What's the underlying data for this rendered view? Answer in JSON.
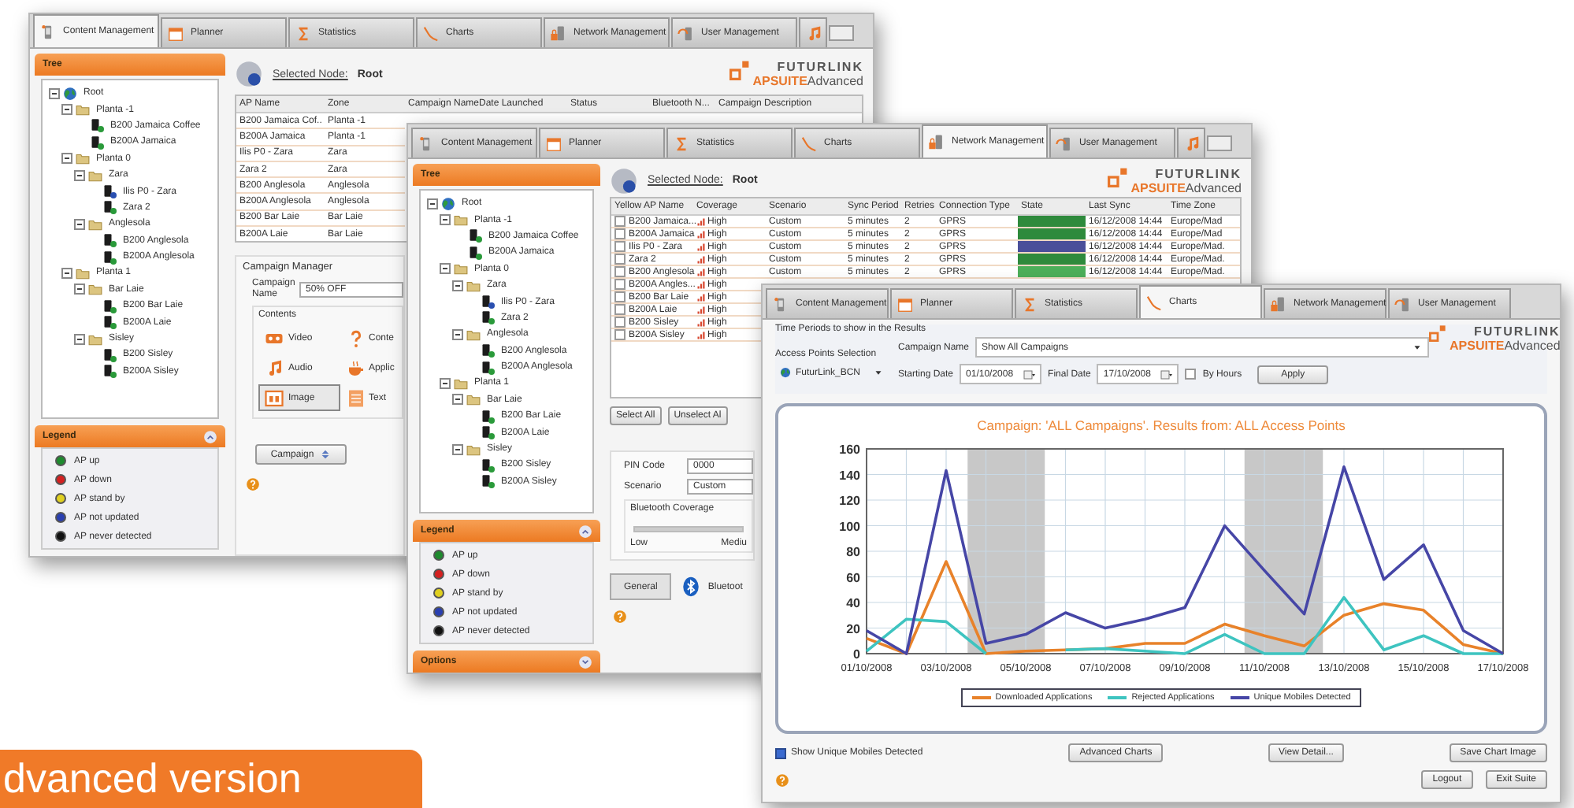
{
  "content_window": {
    "tabs": [
      {
        "label": "Content Management",
        "selected": true
      },
      {
        "label": "Planner",
        "selected": false
      },
      {
        "label": "Statistics",
        "selected": false
      },
      {
        "label": "Charts",
        "selected": false
      },
      {
        "label": "Network Management",
        "selected": false
      },
      {
        "label": "User Management",
        "selected": false
      }
    ],
    "tree_title": "Tree",
    "tree": [
      {
        "label": "Root",
        "kind": "root",
        "expanded": true,
        "children": [
          {
            "label": "Planta -1",
            "kind": "folder",
            "expanded": true,
            "children": [
              {
                "label": "B200 Jamaica Coffee",
                "kind": "device",
                "color": "#2a9a3a"
              },
              {
                "label": "B200A Jamaica",
                "kind": "device",
                "color": "#2a9a3a"
              }
            ]
          },
          {
            "label": "Planta 0",
            "kind": "folder",
            "expanded": true,
            "children": [
              {
                "label": "Zara",
                "kind": "folder",
                "expanded": true,
                "children": [
                  {
                    "label": "Ilis P0 - Zara",
                    "kind": "device",
                    "color": "#2a4fb0"
                  },
                  {
                    "label": "Zara 2",
                    "kind": "device",
                    "color": "#2a9a3a"
                  }
                ]
              },
              {
                "label": "Anglesola",
                "kind": "folder",
                "expanded": true,
                "children": [
                  {
                    "label": "B200 Anglesola",
                    "kind": "device",
                    "color": "#2a9a3a"
                  },
                  {
                    "label": "B200A Anglesola",
                    "kind": "device",
                    "color": "#2a9a3a"
                  }
                ]
              }
            ]
          },
          {
            "label": "Planta 1",
            "kind": "folder",
            "expanded": true,
            "children": [
              {
                "label": "Bar Laie",
                "kind": "folder",
                "expanded": true,
                "children": [
                  {
                    "label": "B200 Bar Laie",
                    "kind": "device",
                    "color": "#2a9a3a"
                  },
                  {
                    "label": "B200A Laie",
                    "kind": "device",
                    "color": "#2a9a3a"
                  }
                ]
              },
              {
                "label": "Sisley",
                "kind": "folder",
                "expanded": true,
                "children": [
                  {
                    "label": "B200 Sisley",
                    "kind": "device",
                    "color": "#2a9a3a"
                  },
                  {
                    "label": "B200A Sisley",
                    "kind": "device",
                    "color": "#2a9a3a"
                  }
                ]
              }
            ]
          }
        ]
      }
    ],
    "legend_title": "Legend",
    "legend": [
      {
        "label": "AP up",
        "color": "#1e8a2e"
      },
      {
        "label": "AP down",
        "color": "#d42020"
      },
      {
        "label": "AP stand by",
        "color": "#e0d020"
      },
      {
        "label": "AP not updated",
        "color": "#2a3fb0"
      },
      {
        "label": "AP never detected",
        "color": "#111111"
      }
    ],
    "selected_node_label": "Selected Node:",
    "selected_node": "Root",
    "logo": {
      "name": "FUTURLINK",
      "product": "APSUITE",
      "edition": "Advanced"
    },
    "table": {
      "columns": [
        "AP Name",
        "Zone",
        "Campaign Name",
        "Date Launched",
        "Status",
        "Bluetooth N...",
        "Campaign Description"
      ],
      "rows": [
        [
          "B200 Jamaica Cof..",
          "Planta -1"
        ],
        [
          "B200A Jamaica",
          "Planta -1"
        ],
        [
          "Ilis P0 - Zara",
          "Zara"
        ],
        [
          "Zara 2",
          "Zara"
        ],
        [
          "B200 Anglesola",
          "Anglesola"
        ],
        [
          "B200A Anglesola",
          "Anglesola"
        ],
        [
          "B200 Bar Laie",
          "Bar Laie"
        ],
        [
          "B200A Laie",
          "Bar Laie"
        ]
      ]
    },
    "campaign_manager": {
      "title": "Campaign Manager",
      "name_label": "Campaign Name",
      "name_value": "50% OFF",
      "contents_label": "Contents",
      "contents": [
        {
          "label": "Video",
          "selected": false
        },
        {
          "label": "Conte",
          "selected": false
        },
        {
          "label": "Audio",
          "selected": false
        },
        {
          "label": "Applic",
          "selected": false
        },
        {
          "label": "Image",
          "selected": true
        },
        {
          "label": "Text",
          "selected": false
        }
      ],
      "button": "Campaign"
    }
  },
  "network_window": {
    "tabs": [
      {
        "label": "Content Management",
        "selected": false
      },
      {
        "label": "Planner",
        "selected": false
      },
      {
        "label": "Statistics",
        "selected": false
      },
      {
        "label": "Charts",
        "selected": false
      },
      {
        "label": "Network Management",
        "selected": true
      },
      {
        "label": "User Management",
        "selected": false
      }
    ],
    "tree_title": "Tree",
    "tree": [
      {
        "label": "Root",
        "kind": "root",
        "expanded": true,
        "children": [
          {
            "label": "Planta -1",
            "kind": "folder",
            "expanded": true,
            "children": [
              {
                "label": "B200 Jamaica Coffee",
                "kind": "device",
                "color": "#2a9a3a"
              },
              {
                "label": "B200A Jamaica",
                "kind": "device",
                "color": "#2a9a3a"
              }
            ]
          },
          {
            "label": "Planta 0",
            "kind": "folder",
            "expanded": true,
            "children": [
              {
                "label": "Zara",
                "kind": "folder",
                "expanded": true,
                "children": [
                  {
                    "label": "Ilis P0 - Zara",
                    "kind": "device",
                    "color": "#2a4fb0"
                  },
                  {
                    "label": "Zara 2",
                    "kind": "device",
                    "color": "#2a9a3a"
                  }
                ]
              },
              {
                "label": "Anglesola",
                "kind": "folder",
                "expanded": true,
                "children": [
                  {
                    "label": "B200 Anglesola",
                    "kind": "device",
                    "color": "#2a9a3a"
                  },
                  {
                    "label": "B200A Anglesola",
                    "kind": "device",
                    "color": "#2a9a3a"
                  }
                ]
              }
            ]
          },
          {
            "label": "Planta 1",
            "kind": "folder",
            "expanded": true,
            "children": [
              {
                "label": "Bar Laie",
                "kind": "folder",
                "expanded": true,
                "children": [
                  {
                    "label": "B200 Bar Laie",
                    "kind": "device",
                    "color": "#2a9a3a"
                  },
                  {
                    "label": "B200A Laie",
                    "kind": "device",
                    "color": "#2a9a3a"
                  }
                ]
              },
              {
                "label": "Sisley",
                "kind": "folder",
                "expanded": true,
                "children": [
                  {
                    "label": "B200 Sisley",
                    "kind": "device",
                    "color": "#2a9a3a"
                  },
                  {
                    "label": "B200A Sisley",
                    "kind": "device",
                    "color": "#2a9a3a"
                  }
                ]
              }
            ]
          }
        ]
      }
    ],
    "legend_title": "Legend",
    "legend": [
      {
        "label": "AP up",
        "color": "#1e8a2e"
      },
      {
        "label": "AP down",
        "color": "#d42020"
      },
      {
        "label": "AP stand by",
        "color": "#e0d020"
      },
      {
        "label": "AP not updated",
        "color": "#2a3fb0"
      },
      {
        "label": "AP never detected",
        "color": "#111111"
      }
    ],
    "options_title": "Options",
    "selected_node_label": "Selected Node:",
    "selected_node": "Root",
    "logo": {
      "name": "FUTURLINK",
      "product": "APSUITE",
      "edition": "Advanced"
    },
    "table": {
      "columns": [
        "Yellow AP Name",
        "Coverage",
        "Scenario",
        "Sync Period",
        "Retries",
        "Connection Type",
        "State",
        "Last Sync",
        "Time Zone"
      ],
      "rows": [
        {
          "checked": false,
          "name": "B200 Jamaica...",
          "coverage": "High",
          "scenario": "Custom",
          "sync_period": "5 minutes",
          "retries": "2",
          "connection": "GPRS",
          "color": "#2e8a3c",
          "last_sync": "16/12/2008 14:44",
          "time_zone": "Europe/Mad"
        },
        {
          "checked": false,
          "name": "B200A Jamaica",
          "coverage": "High",
          "scenario": "Custom",
          "sync_period": "5 minutes",
          "retries": "2",
          "connection": "GPRS",
          "color": "#2e8a3c",
          "last_sync": "16/12/2008 14:44",
          "time_zone": "Europe/Mad"
        },
        {
          "checked": false,
          "name": "Ilis P0 - Zara",
          "coverage": "High",
          "scenario": "Custom",
          "sync_period": "5 minutes",
          "retries": "2",
          "connection": "GPRS",
          "color": "#4a4f9a",
          "last_sync": "16/12/2008 14:44",
          "time_zone": "Europe/Mad."
        },
        {
          "checked": false,
          "name": "Zara 2",
          "coverage": "High",
          "scenario": "Custom",
          "sync_period": "5 minutes",
          "retries": "2",
          "connection": "GPRS",
          "color": "#2e8a3c",
          "last_sync": "16/12/2008 14:44",
          "time_zone": "Europe/Mad."
        },
        {
          "checked": false,
          "name": "B200 Anglesola",
          "coverage": "High",
          "scenario": "Custom",
          "sync_period": "5 minutes",
          "retries": "2",
          "connection": "GPRS",
          "color": "#4caf5a",
          "last_sync": "16/12/2008 14:44",
          "time_zone": "Europe/Mad."
        },
        {
          "checked": false,
          "name": "B200A Angles...",
          "coverage": "High"
        },
        {
          "checked": false,
          "name": "B200 Bar Laie",
          "coverage": "High"
        },
        {
          "checked": false,
          "name": "B200A Laie",
          "coverage": "High"
        },
        {
          "checked": false,
          "name": "B200 Sisley",
          "coverage": "High"
        },
        {
          "checked": false,
          "name": "B200A Sisley",
          "coverage": "High"
        }
      ]
    },
    "select_all": "Select All",
    "unselect_all": "Unselect Al",
    "settings": {
      "pin_label": "PIN Code",
      "pin_value": "0000",
      "scenario_label": "Scenario",
      "scenario_value": "Custom",
      "coverage_title": "Bluetooth Coverage",
      "low": "Low",
      "medium": "Mediu"
    },
    "bottom_tabs": [
      {
        "label": "General",
        "selected": true
      },
      {
        "label": "Bluetoot",
        "selected": false
      }
    ]
  },
  "charts_window": {
    "tabs": [
      {
        "label": "Content Management",
        "selected": false
      },
      {
        "label": "Planner",
        "selected": false
      },
      {
        "label": "Statistics",
        "selected": false
      },
      {
        "label": "Charts",
        "selected": true
      },
      {
        "label": "Network Management",
        "selected": false
      },
      {
        "label": "User Management",
        "selected": false
      }
    ],
    "periods_title": "Time Periods to show in the Results",
    "ap_selection_label": "Access Points Selection",
    "ap_selection": "FuturLink_BCN",
    "campaign_label": "Campaign Name",
    "campaign": "Show All Campaigns",
    "start_label": "Starting Date",
    "start": "01/10/2008",
    "final_label": "Final Date",
    "final": "17/10/2008",
    "by_hours": {
      "label": "By Hours",
      "checked": false
    },
    "apply": "Apply",
    "logo": {
      "name": "FUTURLINK",
      "product": "APSUITE",
      "edition": "Advanced"
    },
    "chart_data": {
      "type": "line",
      "title": "Campaign: 'ALL Campaigns'. Results from:  ALL Access Points",
      "categories": [
        "01/10/2008",
        null,
        "03/10/2008",
        null,
        "05/10/2008",
        null,
        "07/10/2008",
        null,
        "09/10/2008",
        null,
        "11/10/2008",
        null,
        "13/10/2008",
        null,
        "15/10/2008",
        null,
        "17/10/2008"
      ],
      "grid": true,
      "legend": "bottom",
      "ylim": [
        0,
        160
      ],
      "yticks": [
        0,
        20,
        40,
        60,
        80,
        100,
        120,
        140,
        160
      ],
      "series": [
        {
          "name": "Downloaded Applications",
          "color": "#e8822a",
          "values": [
            12,
            0,
            72,
            0,
            2,
            3,
            4,
            8,
            8,
            23,
            14,
            6,
            30,
            39,
            34,
            7,
            0
          ]
        },
        {
          "name": "Rejected Applications",
          "color": "#3ec4c0",
          "values": [
            2,
            27,
            25,
            0,
            null,
            3,
            4,
            2,
            0,
            15,
            0,
            0,
            44,
            3,
            14,
            0,
            0
          ]
        },
        {
          "name": "Unique Mobiles Detected",
          "color": "#4646a6",
          "values": [
            18,
            0,
            143,
            8,
            15,
            32,
            20,
            27,
            36,
            100,
            65,
            31,
            146,
            58,
            85,
            18,
            0
          ]
        }
      ]
    },
    "show_unique": {
      "label": "Show Unique Mobiles Detected",
      "checked": true
    },
    "buttons": [
      "Advanced Charts",
      "View Detail...",
      "Save Chart Image"
    ],
    "footer_buttons": [
      "Logout",
      "Exit Suite"
    ]
  },
  "banner": "dvanced version"
}
